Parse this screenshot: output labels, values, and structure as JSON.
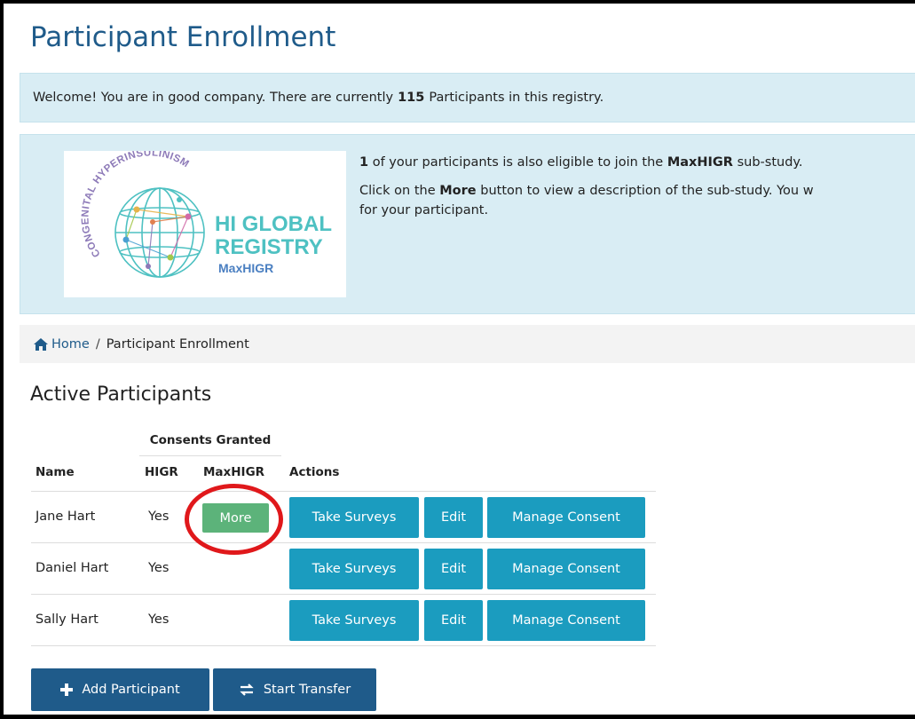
{
  "page": {
    "title": "Participant Enrollment"
  },
  "welcome": {
    "before": "Welcome! You are in good company. There are currently",
    "count": "115",
    "after": "Participants in this registry."
  },
  "substudy": {
    "logo": {
      "line1": "HI GLOBAL",
      "line2": "REGISTRY",
      "line3": "MaxHIGR",
      "arc_text": "CONGENITAL HYPERINSULINISM"
    },
    "eligible_count": "1",
    "eligible_text_a": "of your participants is also eligible to join the",
    "eligible_study": "MaxHIGR",
    "eligible_text_b": "sub-study.",
    "click_text_a": "Click on the",
    "click_more": "More",
    "click_text_b": "button to view a description of the sub-study. You w",
    "click_text_c": "for your participant."
  },
  "breadcrumb": {
    "home": "Home",
    "separator": "/",
    "current": "Participant Enrollment"
  },
  "section": {
    "title": "Active Participants"
  },
  "table": {
    "group_header": "Consents Granted",
    "columns": {
      "name": "Name",
      "higr": "HIGR",
      "maxhigr": "MaxHIGR",
      "actions": "Actions"
    },
    "rows": [
      {
        "name": "Jane Hart",
        "higr": "Yes",
        "more": "More",
        "take_surveys": "Take Surveys",
        "edit": "Edit",
        "manage_consent": "Manage Consent"
      },
      {
        "name": "Daniel Hart",
        "higr": "Yes",
        "take_surveys": "Take Surveys",
        "edit": "Edit",
        "manage_consent": "Manage Consent"
      },
      {
        "name": "Sally Hart",
        "higr": "Yes",
        "take_surveys": "Take Surveys",
        "edit": "Edit",
        "manage_consent": "Manage Consent"
      }
    ]
  },
  "footer": {
    "add_participant": "Add Participant",
    "start_transfer": "Start Transfer"
  },
  "icons": {
    "home": "home-icon",
    "plus": "plus-icon",
    "transfer": "transfer-icon"
  },
  "colors": {
    "title": "#1f5b8a",
    "info_bg": "#d9edf4",
    "teal_button": "#1b9cbf",
    "green_button": "#5cb37a",
    "dark_button": "#1f5b8a",
    "highlight": "#e0181b"
  }
}
